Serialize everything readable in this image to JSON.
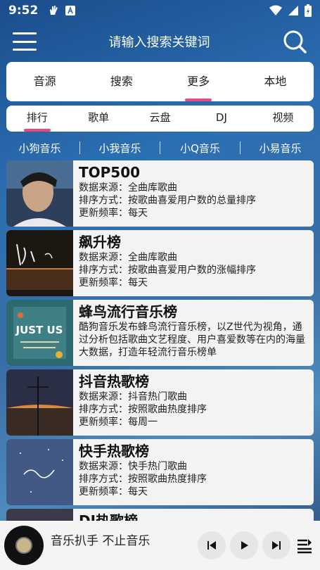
{
  "status": {
    "time": "9:52"
  },
  "header": {
    "search_placeholder": "请输入搜索关键词"
  },
  "tabs_main": [
    "音源",
    "搜索",
    "更多",
    "本地"
  ],
  "tabs_main_active": "更多",
  "tabs_sub": [
    "排行",
    "歌单",
    "云盘",
    "DJ",
    "视频"
  ],
  "tabs_sub_active": "排行",
  "sources": [
    "小狗音乐",
    "小我音乐",
    "小Q音乐",
    "小易音乐"
  ],
  "charts": [
    {
      "title": "TOP500",
      "lines": [
        "数据来源：全曲库歌曲",
        "排序方式：按歌曲喜爱用户数的总量排序",
        "更新频率：每天"
      ]
    },
    {
      "title": "飙升榜",
      "lines": [
        "数据来源：全曲库歌曲",
        "排序方式：按歌曲喜爱用户数的涨幅排序",
        "更新频率：每天"
      ]
    },
    {
      "title": "蜂鸟流行音乐榜",
      "desc": "酷狗音乐发布蜂鸟流行音乐榜，以Z世代为视角，通过分析包括歌曲文艺程度、用户喜爱数等在内的海量大数据，打造年轻流行音乐榜单"
    },
    {
      "title": "抖音热歌榜",
      "lines": [
        "数据来源：抖音热门歌曲",
        "排序方式：按照歌曲热度排序",
        "更新频率：每周一"
      ]
    },
    {
      "title": "快手热歌榜",
      "lines": [
        "数据来源：快手热门歌曲",
        "排序方式：按照歌曲热度排序",
        "更新频率：每天"
      ]
    },
    {
      "title": "DJ热歌榜",
      "lines": []
    }
  ],
  "player": {
    "now_playing": "音乐扒手 不止音乐"
  },
  "colors": {
    "accent": "#e84b7a",
    "bg": "#2b6fb3"
  },
  "icons": [
    "menu-icon",
    "search-icon",
    "prev-icon",
    "play-icon",
    "next-icon",
    "playlist-icon"
  ]
}
